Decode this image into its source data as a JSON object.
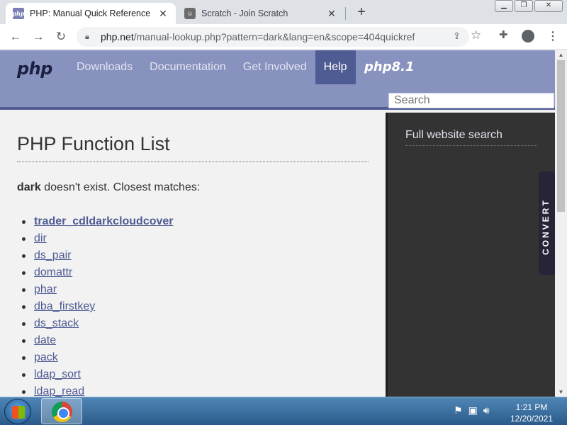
{
  "browser": {
    "tabs": [
      {
        "title": "PHP: Manual Quick Reference",
        "favicon": "php-favicon-icon",
        "active": true
      },
      {
        "title": "Scratch - Join Scratch",
        "favicon": "scratch-favicon-icon",
        "active": false
      }
    ],
    "url_host": "php.net",
    "url_path": "/manual-lookup.php?pattern=dark&lang=en&scope=404quickref"
  },
  "site": {
    "logo": "php",
    "nav": [
      "Downloads",
      "Documentation",
      "Get Involved",
      "Help"
    ],
    "active_nav": "Help",
    "version_logo": "php8.1",
    "search_placeholder": "Search"
  },
  "main": {
    "title": "PHP Function List",
    "query": "dark",
    "message": " doesn't exist. Closest matches:",
    "results": [
      "trader_cdldarkcloudcover",
      "dir",
      "ds_pair",
      "domattr",
      "phar",
      "dba_firstkey",
      "ds_stack",
      "date",
      "pack",
      "ldap_sort",
      "ldap_read"
    ]
  },
  "sidebar": {
    "title": "Full website search",
    "convert_label": "CONVERT"
  },
  "taskbar": {
    "time": "1:21 PM",
    "date": "12/20/2021"
  },
  "colors": {
    "php_header": "#8892bf",
    "php_dark": "#4f5b93",
    "sidebar": "#333333",
    "link": "#4f5b93"
  }
}
